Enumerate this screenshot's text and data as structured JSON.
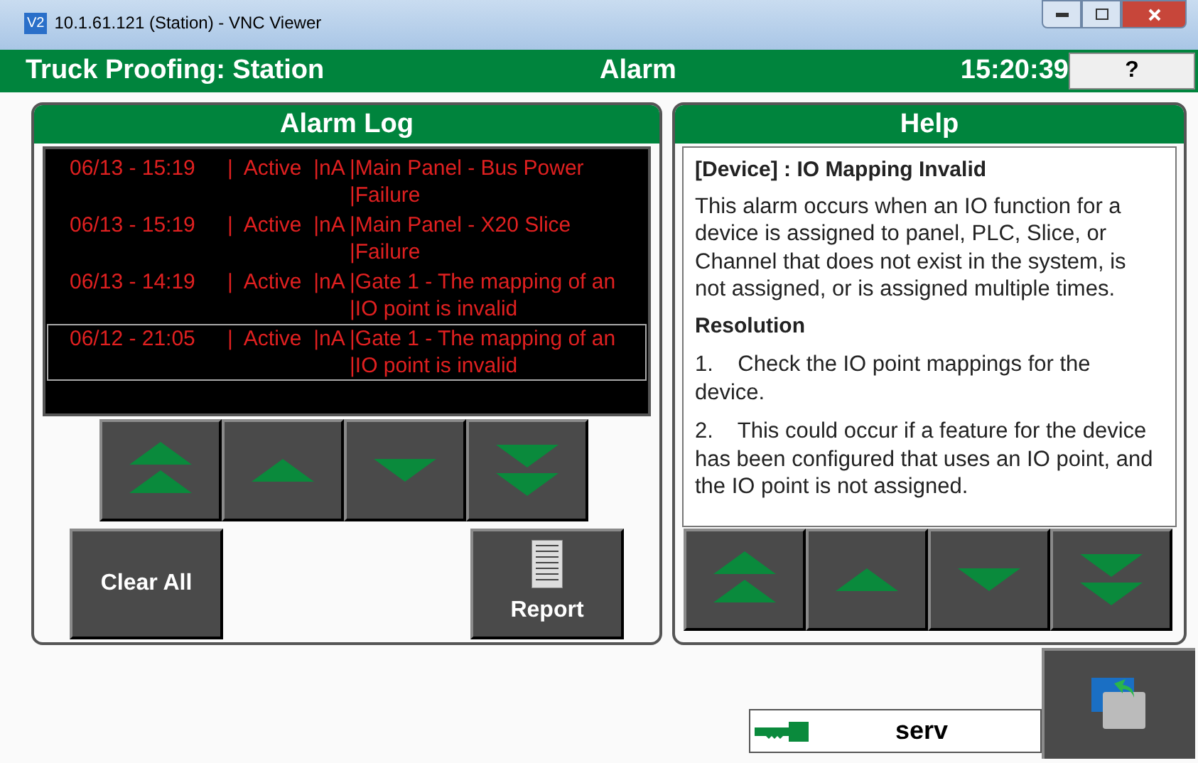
{
  "window": {
    "title": "10.1.61.121 (Station) - VNC Viewer",
    "app_icon": "V2"
  },
  "header": {
    "title": "Truck Proofing: Station",
    "screen": "Alarm",
    "time": "15:20:39",
    "help_button": "?"
  },
  "alarm_log": {
    "title": "Alarm Log",
    "rows": [
      {
        "time": "06/13 - 15:19",
        "status": "|  Active  |nA",
        "message": [
          "|Main Panel - Bus Power",
          "|Failure"
        ],
        "selected": false
      },
      {
        "time": "06/13 - 15:19",
        "status": "|  Active  |nA",
        "message": [
          "|Main Panel - X20 Slice",
          "|Failure"
        ],
        "selected": false
      },
      {
        "time": "06/13 - 14:19",
        "status": "|  Active  |nA",
        "message": [
          "|Gate 1 - The mapping of an",
          "|IO point is invalid"
        ],
        "selected": false
      },
      {
        "time": "06/12 - 21:05",
        "status": "|  Active  |nA",
        "message": [
          "|Gate 1 - The mapping of an",
          "|IO point is invalid"
        ],
        "selected": true
      }
    ],
    "buttons": [
      {
        "label": "Clear All",
        "kind": "text"
      },
      {
        "label": "Report",
        "kind": "report"
      }
    ]
  },
  "help": {
    "title": "Help",
    "heading": "[Device] : IO Mapping Invalid",
    "description": "This alarm occurs when an IO function for a device is assigned to panel, PLC, Slice, or Channel that does not exist in the system, is not assigned, or is assigned multiple times.",
    "resolution_heading": "Resolution",
    "steps": [
      {
        "number": "1.",
        "text": "Check the IO point mappings for the device."
      },
      {
        "number": "2.",
        "text": "This could occur if a feature for the device has been configured that uses an IO point, and the IO point is not assigned."
      }
    ]
  },
  "status": {
    "user": "serv"
  }
}
